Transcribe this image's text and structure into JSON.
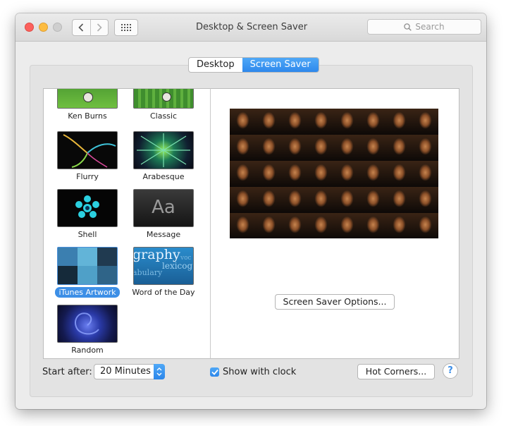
{
  "window": {
    "title": "Desktop & Screen Saver",
    "search_placeholder": "Search"
  },
  "tabs": [
    {
      "label": "Desktop",
      "active": false
    },
    {
      "label": "Screen Saver",
      "active": true
    }
  ],
  "savers": [
    {
      "label": "Ken Burns",
      "icon": "ken-burns-thumbnail"
    },
    {
      "label": "Classic",
      "icon": "classic-thumbnail"
    },
    {
      "label": "Flurry",
      "icon": "flurry-thumbnail"
    },
    {
      "label": "Arabesque",
      "icon": "arabesque-thumbnail"
    },
    {
      "label": "Shell",
      "icon": "shell-thumbnail"
    },
    {
      "label": "Message",
      "icon": "message-thumbnail",
      "glyph": "Aa"
    },
    {
      "label": "iTunes Artwork",
      "icon": "itunes-artwork-thumbnail",
      "selected": true
    },
    {
      "label": "Word of the Day",
      "icon": "word-of-the-day-thumbnail",
      "words": [
        "graphy",
        "lexicog",
        "abulary",
        "voc"
      ]
    },
    {
      "label": "Random",
      "icon": "random-thumbnail"
    }
  ],
  "preview": {
    "options_button": "Screen Saver Options..."
  },
  "footer": {
    "start_after_label": "Start after:",
    "start_after_value": "20 Minutes",
    "show_clock_label": "Show with clock",
    "show_clock_checked": true,
    "hot_corners_label": "Hot Corners...",
    "help_label": "?"
  },
  "colors": {
    "accent": "#3d8fe6",
    "close": "#fc605c",
    "minimize": "#fdbc40",
    "zoom_disabled": "#cfcfcf"
  }
}
